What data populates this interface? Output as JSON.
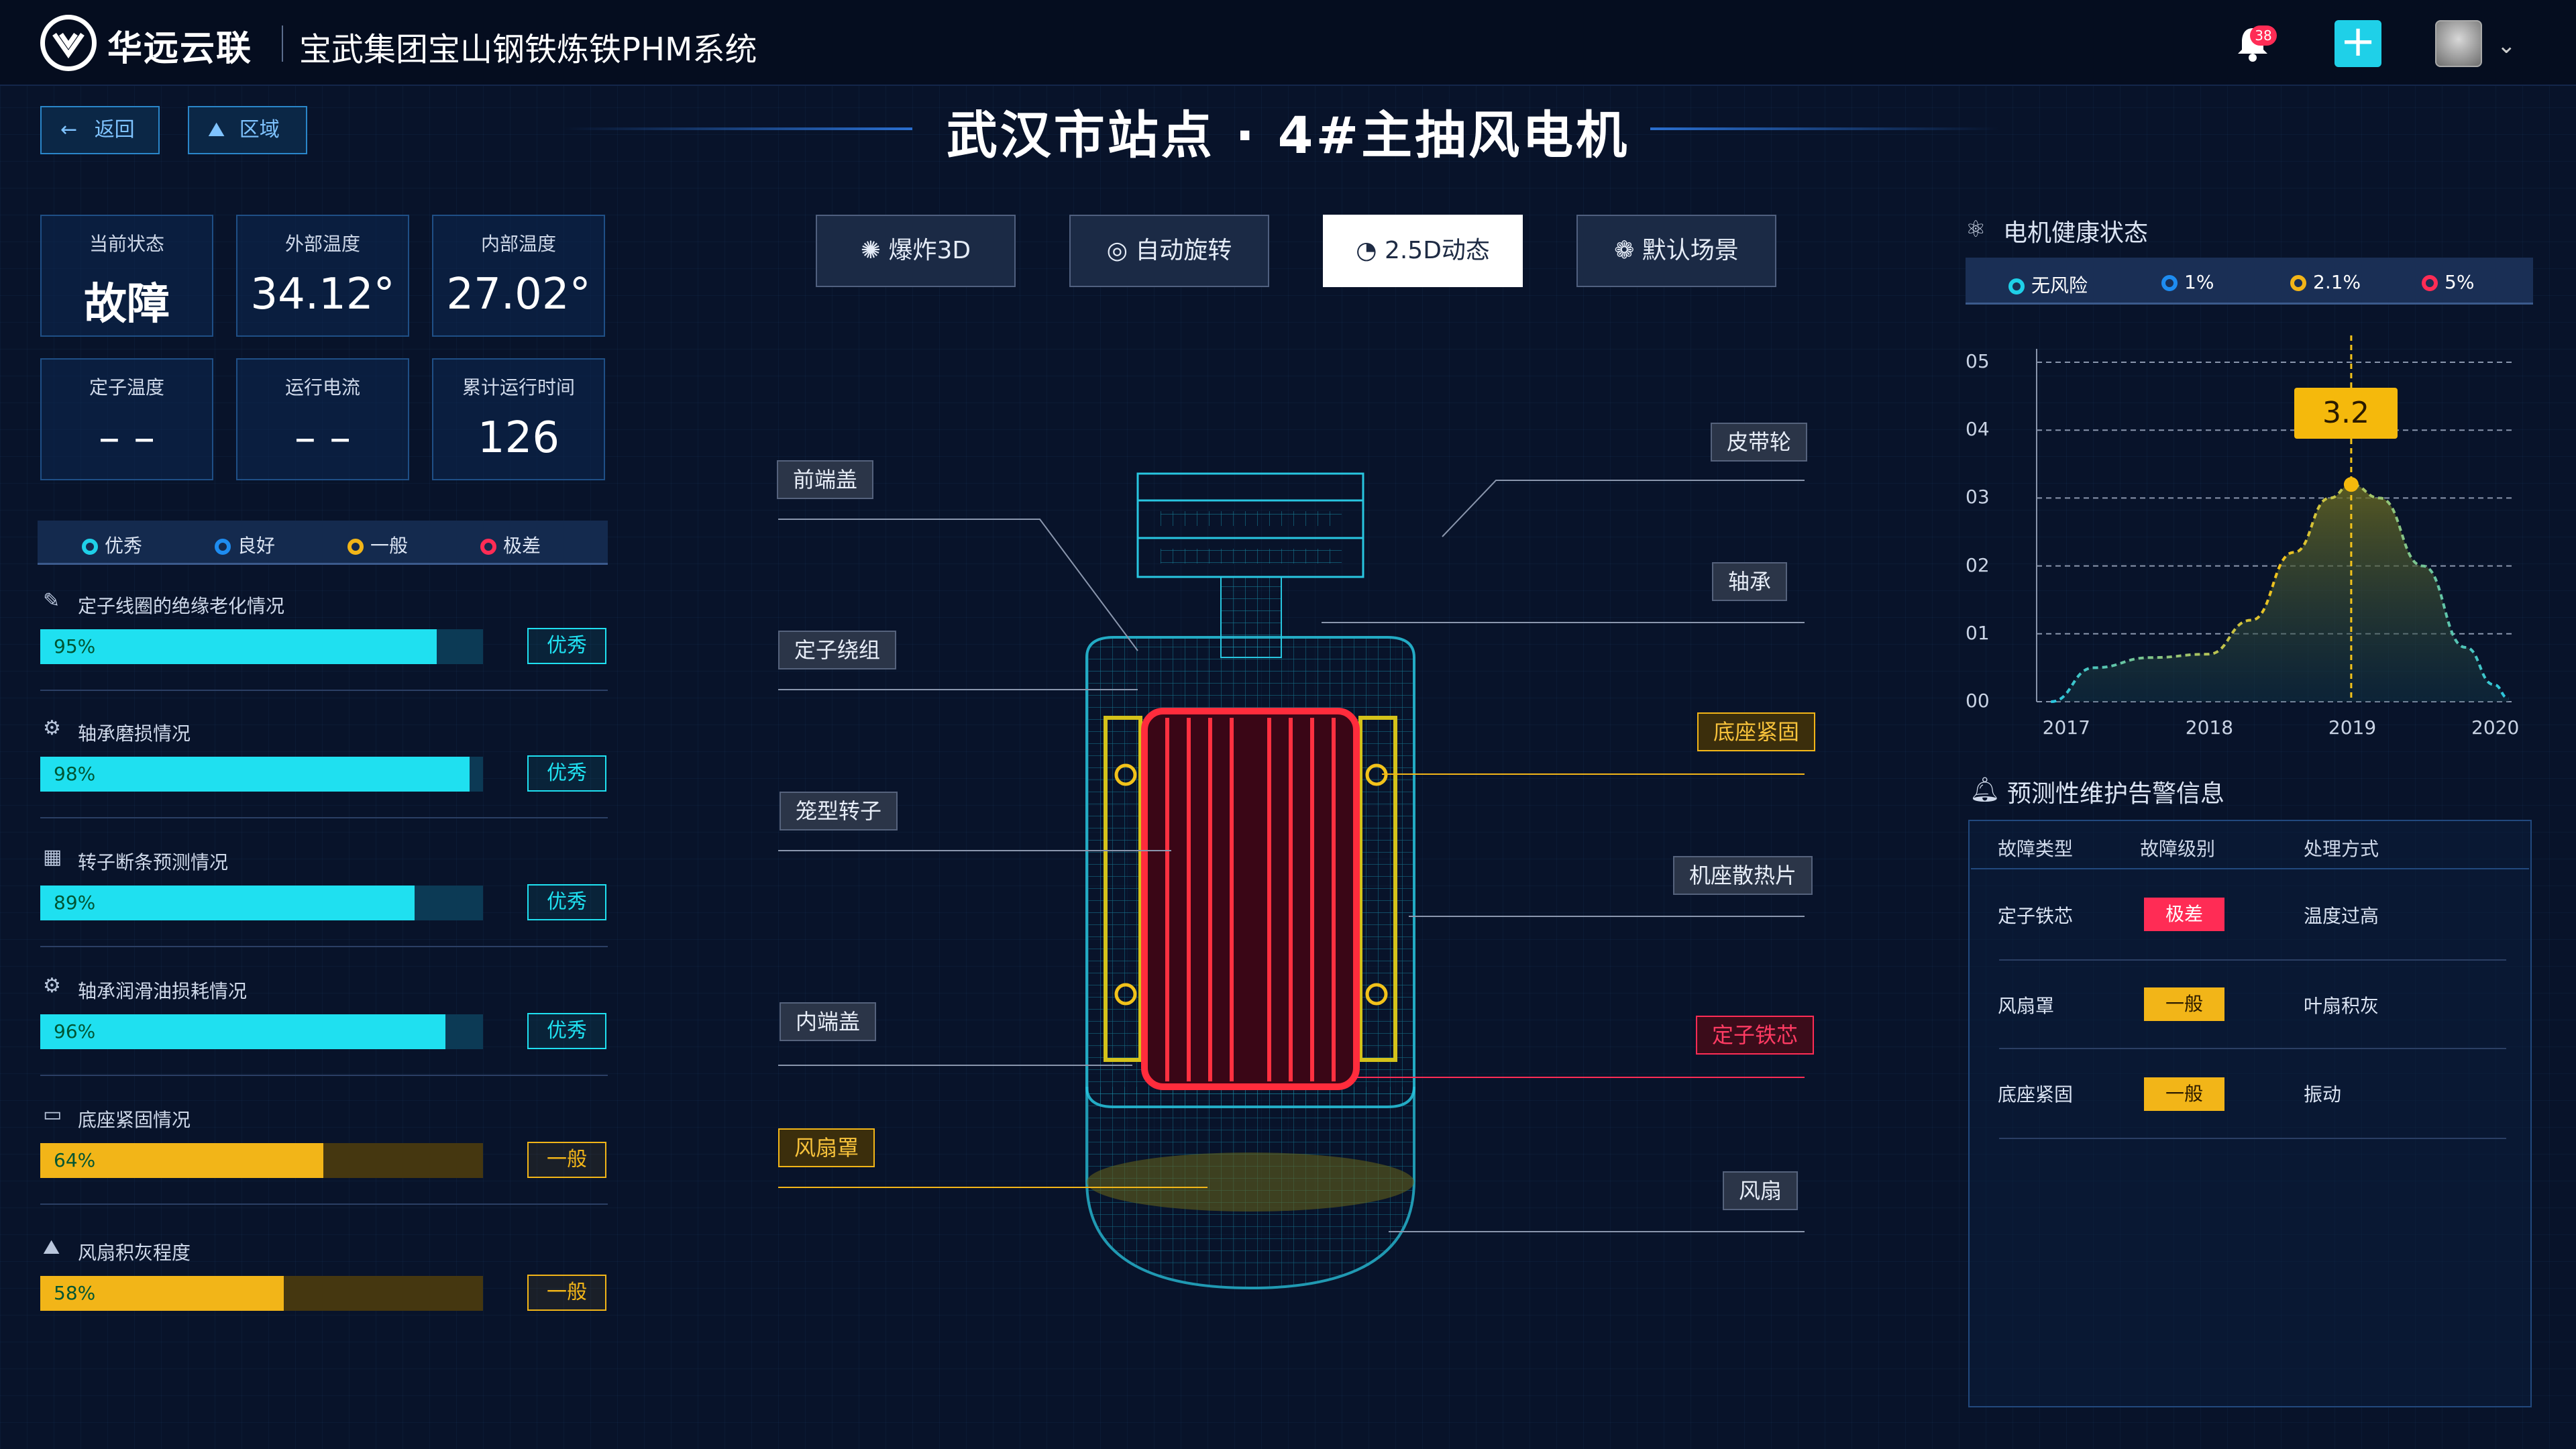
{
  "header": {
    "brand": "华远云联",
    "system_title": "宝武集团宝山钢铁炼铁PHM系统",
    "notification_count": "38"
  },
  "nav": {
    "back_label": "返回",
    "region_label": "区域"
  },
  "page_title": "武汉市站点 · 4#主抽风电机",
  "status_cards": [
    {
      "label": "当前状态",
      "value": "故障",
      "icon": "status-icon"
    },
    {
      "label": "外部温度",
      "value": "34.12°",
      "icon": "thermometer-icon"
    },
    {
      "label": "内部温度",
      "value": "27.02°",
      "icon": "thermometer-icon"
    },
    {
      "label": "定子温度",
      "value": "– –",
      "icon": "thermometer-icon"
    },
    {
      "label": "运行电流",
      "value": "– –",
      "icon": "lightning-icon"
    },
    {
      "label": "累计运行时间",
      "value": "126",
      "icon": "clock-icon"
    }
  ],
  "rating_legend": [
    {
      "label": "优秀",
      "color": "#1fd0e8"
    },
    {
      "label": "良好",
      "color": "#1e8cf0"
    },
    {
      "label": "一般",
      "color": "#f2b518"
    },
    {
      "label": "极差",
      "color": "#ff2c55"
    }
  ],
  "metrics": [
    {
      "title": "定子线圈的绝缘老化情况",
      "percent": 95,
      "display": "95%",
      "fill_fraction": 0.895,
      "rating": "优秀",
      "level": "good"
    },
    {
      "title": "轴承磨损情况",
      "percent": 98,
      "display": "98%",
      "fill_fraction": 0.97,
      "rating": "优秀",
      "level": "good"
    },
    {
      "title": "转子断条预测情况",
      "percent": 89,
      "display": "89%",
      "fill_fraction": 0.845,
      "rating": "优秀",
      "level": "good"
    },
    {
      "title": "轴承润滑油损耗情况",
      "percent": 96,
      "display": "96%",
      "fill_fraction": 0.915,
      "rating": "优秀",
      "level": "good"
    },
    {
      "title": "底座紧固情况",
      "percent": 64,
      "display": "64%",
      "fill_fraction": 0.64,
      "rating": "一般",
      "level": "normal"
    },
    {
      "title": "风扇积灰程度",
      "percent": 58,
      "display": "58%",
      "fill_fraction": 0.55,
      "rating": "一般",
      "level": "normal"
    }
  ],
  "view_buttons": [
    {
      "label": "爆炸3D",
      "active": false
    },
    {
      "label": "自动旋转",
      "active": false
    },
    {
      "label": "2.5D动态",
      "active": true
    },
    {
      "label": "默认场景",
      "active": false
    }
  ],
  "parts": {
    "front_cover": "前端盖",
    "stator_winding": "定子绕组",
    "cage_rotor": "笼型转子",
    "inner_cover": "内端盖",
    "fan_cover": "风扇罩",
    "pulley": "皮带轮",
    "bearing": "轴承",
    "base_fastening": "底座紧固",
    "heat_sink": "机座散热片",
    "stator_core": "定子铁芯",
    "fan": "风扇"
  },
  "health": {
    "title": "电机健康状态",
    "legend": [
      {
        "label": "无风险",
        "color": "#1fd0e8"
      },
      {
        "label": "1%",
        "color": "#1e8cf0"
      },
      {
        "label": "2.1%",
        "color": "#f2b518"
      },
      {
        "label": "5%",
        "color": "#ff2c55"
      }
    ],
    "tooltip": "3.2"
  },
  "chart_data": {
    "type": "area",
    "x": [
      2016.9,
      2017.2,
      2017.6,
      2018.0,
      2018.3,
      2018.6,
      2018.85,
      2019.0,
      2019.2,
      2019.5,
      2019.8,
      2020.0,
      2020.1
    ],
    "y": [
      0.0,
      0.5,
      0.65,
      0.7,
      1.2,
      2.2,
      3.0,
      3.2,
      3.0,
      2.0,
      0.8,
      0.25,
      0.05
    ],
    "x_ticks": [
      "2017",
      "2018",
      "2019",
      "2020"
    ],
    "y_ticks": [
      "00",
      "01",
      "02",
      "03",
      "04",
      "05"
    ],
    "xlim": [
      2016.8,
      2020.15
    ],
    "ylim": [
      0,
      5
    ],
    "highlight": {
      "x": 2019.0,
      "y": 3.2
    },
    "grid": true
  },
  "alerts": {
    "title": "预测性维护告警信息",
    "headers": [
      "故障类型",
      "故障级别",
      "处理方式"
    ],
    "rows": [
      {
        "type": "定子铁芯",
        "level": "极差",
        "level_color": "#ff2c55",
        "action": "温度过高"
      },
      {
        "type": "风扇罩",
        "level": "一般",
        "level_color": "#f2b518",
        "action": "叶扇积灰"
      },
      {
        "type": "底座紧固",
        "level": "一般",
        "level_color": "#f2b518",
        "action": "振动"
      }
    ]
  }
}
